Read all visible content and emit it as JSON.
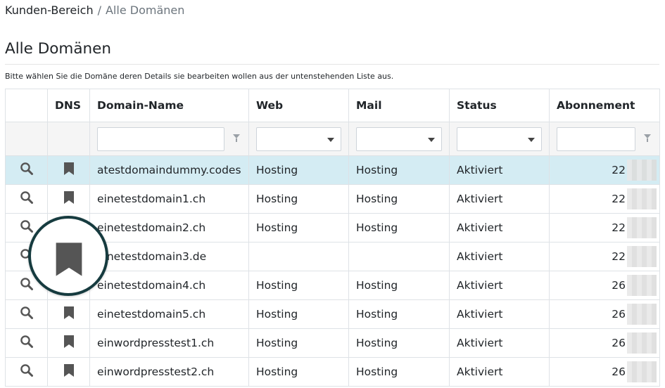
{
  "breadcrumb": {
    "parent": "Kunden-Bereich",
    "separator": "/",
    "current": "Alle Domänen"
  },
  "page": {
    "title": "Alle Domänen",
    "subtitle": "Bitte wählen Sie die Domäne deren Details sie bearbeiten wollen aus der untenstehenden Liste aus."
  },
  "table": {
    "columns": [
      "",
      "DNS",
      "Domain-Name",
      "Web",
      "Mail",
      "Status",
      "Abonnement"
    ],
    "filters": {
      "domain_name": "",
      "web": "",
      "mail": "",
      "status": "",
      "abonnement": ""
    },
    "rows": [
      {
        "domain": "atestdomaindummy.codes",
        "web": "Hosting",
        "mail": "Hosting",
        "status": "Aktiviert",
        "abo": "22",
        "selected": true
      },
      {
        "domain": "einetestdomain1.ch",
        "web": "Hosting",
        "mail": "Hosting",
        "status": "Aktiviert",
        "abo": "22"
      },
      {
        "domain": "einetestdomain2.ch",
        "web": "Hosting",
        "mail": "Hosting",
        "status": "Aktiviert",
        "abo": "22"
      },
      {
        "domain": "einetestdomain3.de",
        "web": "",
        "mail": "",
        "status": "Aktiviert",
        "abo": "22"
      },
      {
        "domain": "einetestdomain4.ch",
        "web": "Hosting",
        "mail": "Hosting",
        "status": "Aktiviert",
        "abo": "26"
      },
      {
        "domain": "einetestdomain5.ch",
        "web": "Hosting",
        "mail": "Hosting",
        "status": "Aktiviert",
        "abo": "26"
      },
      {
        "domain": "einwordpresstest1.ch",
        "web": "Hosting",
        "mail": "Hosting",
        "status": "Aktiviert",
        "abo": "26"
      },
      {
        "domain": "einwordpresstest2.ch",
        "web": "Hosting",
        "mail": "Hosting",
        "status": "Aktiviert",
        "abo": "26"
      }
    ]
  },
  "icons": {
    "row_detail": "search-icon",
    "dns": "bookmark-icon",
    "filter": "filter-icon",
    "dropdown": "chevron-down-icon"
  },
  "colors": {
    "selected_row": "#d4ecf3",
    "icon": "#555555",
    "magnifier_ring": "#163b3f"
  }
}
